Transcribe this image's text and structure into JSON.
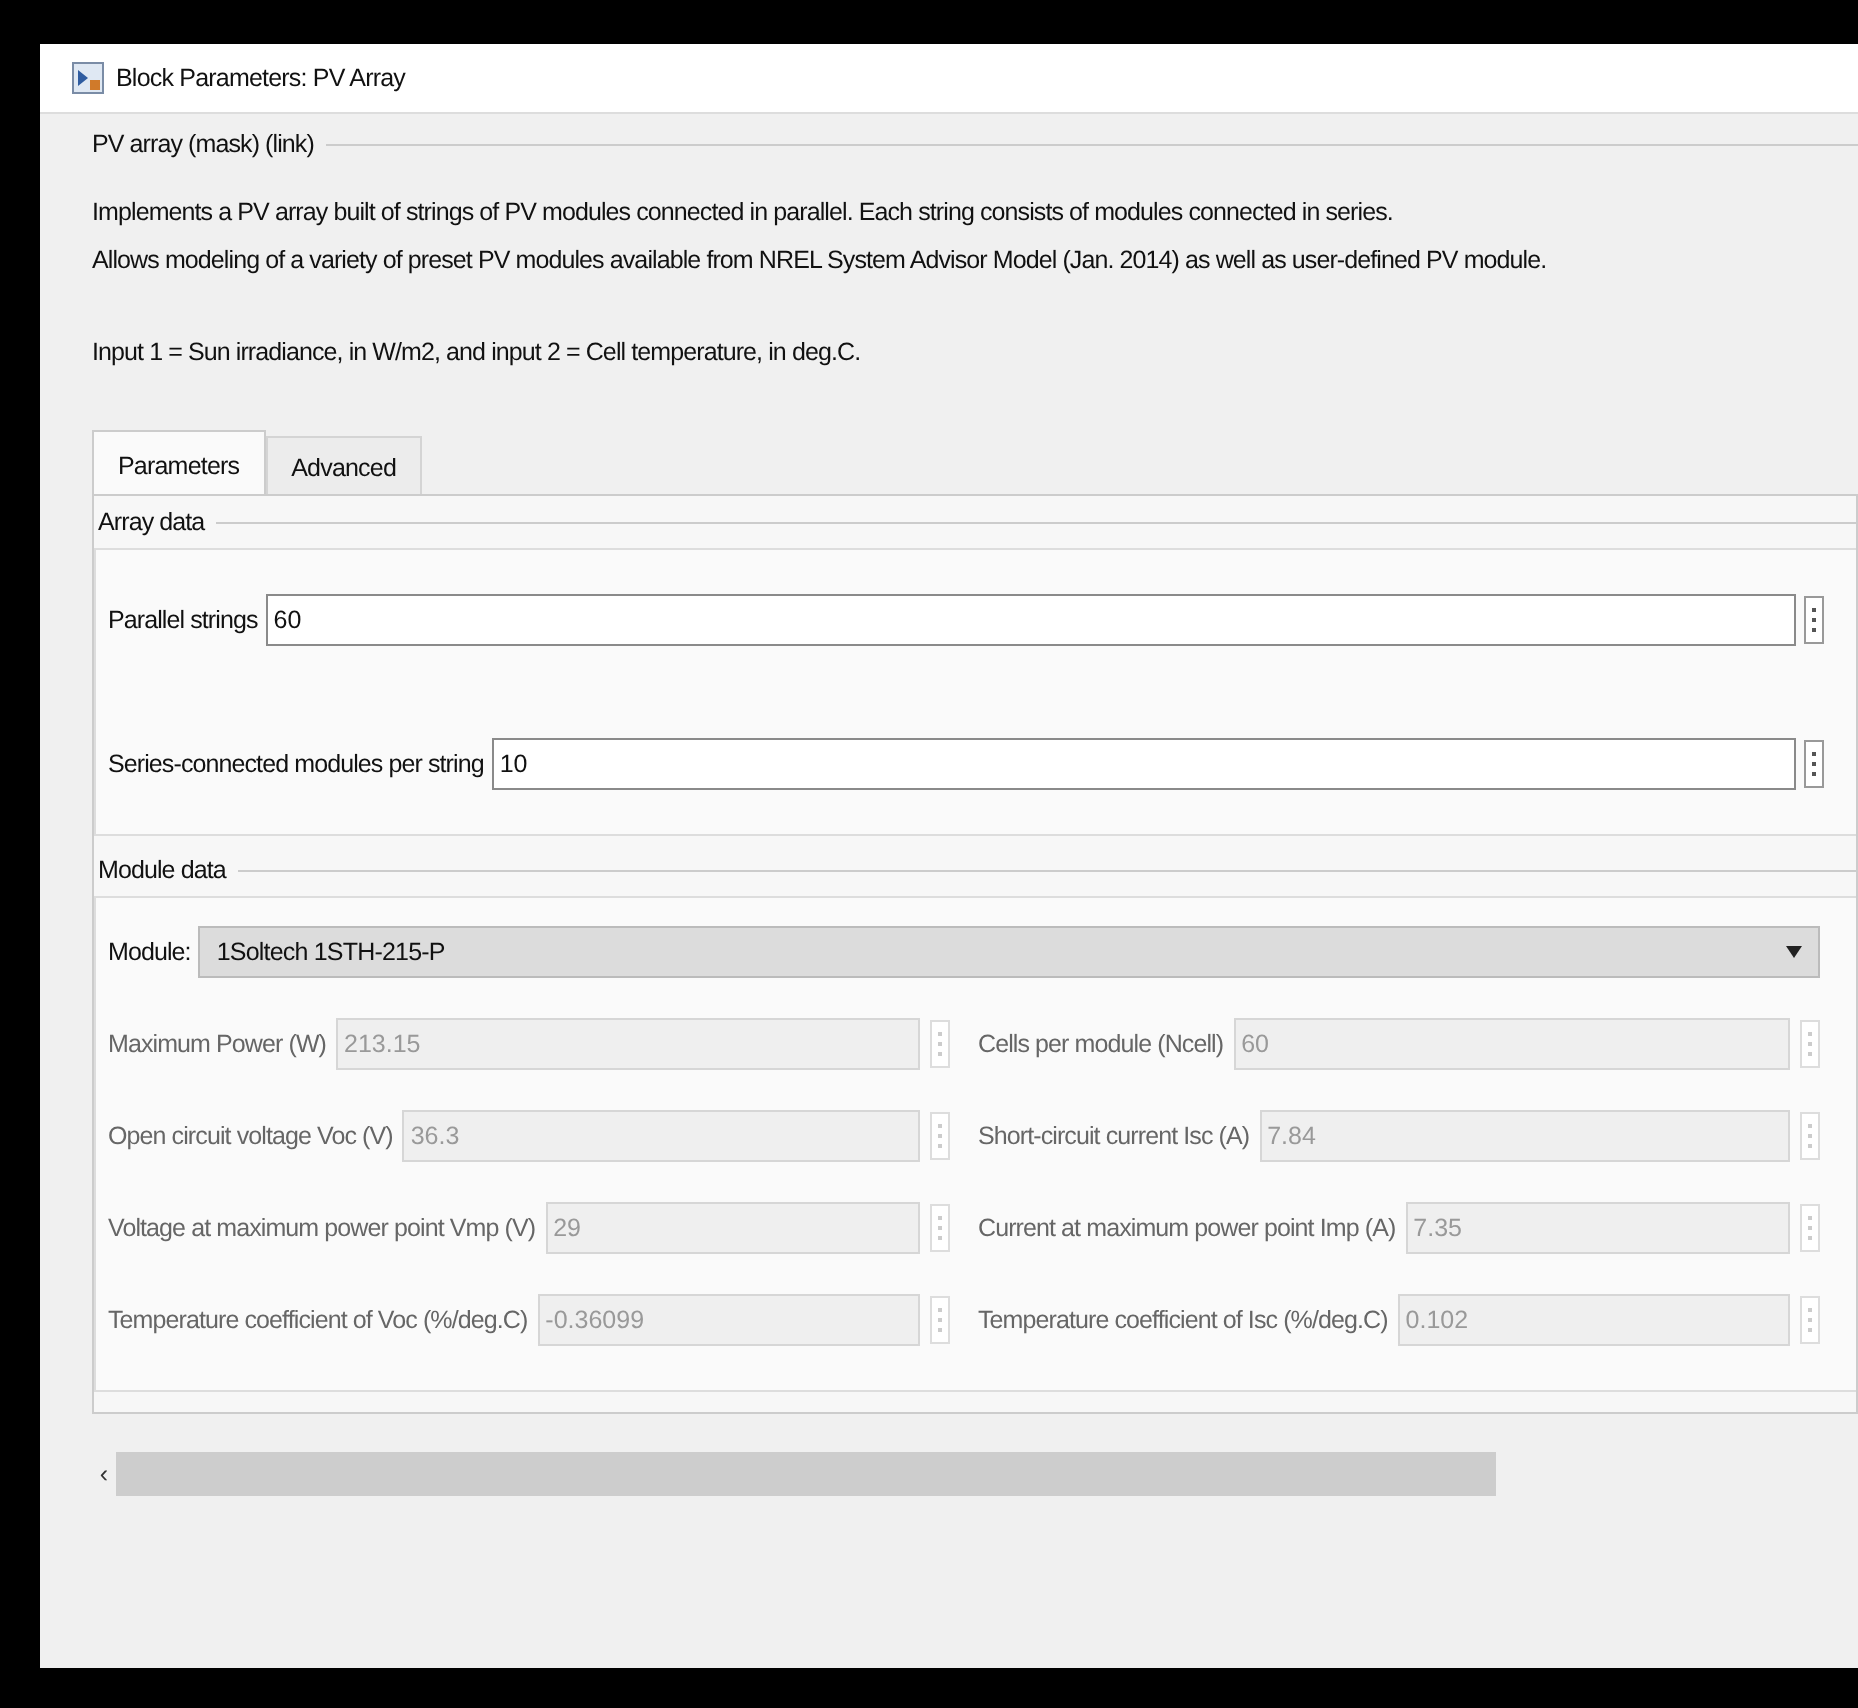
{
  "window": {
    "title": "Block Parameters: PV Array"
  },
  "mask": {
    "title": "PV array (mask) (link)",
    "description": [
      "Implements a PV array built of strings of PV modules connected in parallel. Each string consists of modules connected in series.",
      "Allows modeling of a variety of preset PV modules available from NREL System Advisor Model (Jan. 2014) as well as user-defined PV module.",
      "Input 1 = Sun irradiance, in W/m2, and input 2 = Cell temperature, in deg.C."
    ]
  },
  "tabs": [
    {
      "label": "Parameters",
      "selected": true
    },
    {
      "label": "Advanced",
      "selected": false
    }
  ],
  "array_data": {
    "title": "Array data",
    "fields": [
      {
        "label": "Parallel strings",
        "value": "60",
        "disabled": false
      },
      {
        "label": "Series-connected modules per string",
        "value": "10",
        "disabled": false
      }
    ]
  },
  "module_data": {
    "title": "Module data",
    "module": {
      "label": "Module:",
      "value": "1Soltech 1STH-215-P"
    },
    "fields": [
      {
        "label": "Maximum Power (W)",
        "value": "213.15",
        "disabled": true
      },
      {
        "label": "Cells per module (Ncell)",
        "value": "60",
        "disabled": true
      },
      {
        "label": "Open circuit voltage  Voc (V)",
        "value": "36.3",
        "disabled": true
      },
      {
        "label": "Short-circuit current Isc (A)",
        "value": "7.84",
        "disabled": true
      },
      {
        "label": "Voltage at maximum power point Vmp (V)",
        "value": "29",
        "disabled": true
      },
      {
        "label": "Current at maximum power point Imp (A)",
        "value": "7.35",
        "disabled": true
      },
      {
        "label": "Temperature coefficient of Voc (%/deg.C)",
        "value": "-0.36099",
        "disabled": true
      },
      {
        "label": "Temperature coefficient of Isc (%/deg.C)",
        "value": "0.102",
        "disabled": true
      }
    ]
  },
  "scrollbar": {
    "left_arrow": "‹"
  }
}
